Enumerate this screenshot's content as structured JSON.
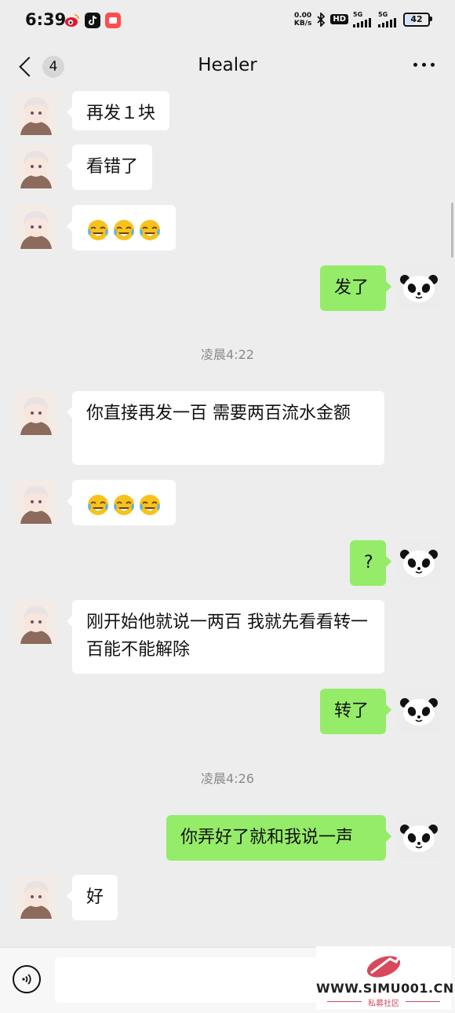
{
  "status_bar": {
    "time": "6:39",
    "net_speed_value": "0.00",
    "net_speed_unit": "KB/s",
    "hd_label": "HD",
    "sim1_label": "5G",
    "sim2_label": "5G",
    "battery_level": "42",
    "apps": [
      "weibo-icon",
      "douyin-icon",
      "community-icon"
    ]
  },
  "header": {
    "unread_count": "4",
    "title": "Healer"
  },
  "messages": [
    {
      "from": "them",
      "text": "再发１块"
    },
    {
      "from": "them",
      "text": "看错了"
    },
    {
      "from": "them",
      "text": "",
      "emojis": [
        "laugh-cry-emoji",
        "laugh-cry-emoji",
        "laugh-cry-emoji"
      ]
    },
    {
      "from": "me",
      "text": "发了"
    },
    {
      "type": "time",
      "text": "凌晨4:22"
    },
    {
      "from": "them",
      "text": "你直接再发一百  需要两百流水金额"
    },
    {
      "from": "them",
      "text": "",
      "emojis": [
        "laugh-cry-emoji",
        "laugh-cry-emoji",
        "laugh-cry-emoji"
      ]
    },
    {
      "from": "me",
      "text": "?"
    },
    {
      "from": "them",
      "text": "刚开始他就说一两百  我就先看看转一百能不能解除"
    },
    {
      "from": "me",
      "text": "转了"
    },
    {
      "type": "time",
      "text": "凌晨4:26"
    },
    {
      "from": "me",
      "text": "你弄好了就和我说一声"
    },
    {
      "from": "them",
      "text": "好"
    }
  ],
  "input": {
    "value": "",
    "placeholder": ""
  },
  "watermark": {
    "url": "WWW.SIMU001.CN",
    "subtitle": "私募社区"
  },
  "colors": {
    "background": "#ededed",
    "my_bubble": "#95ec69",
    "their_bubble": "#ffffff",
    "timestamp": "#8a8a8a"
  }
}
